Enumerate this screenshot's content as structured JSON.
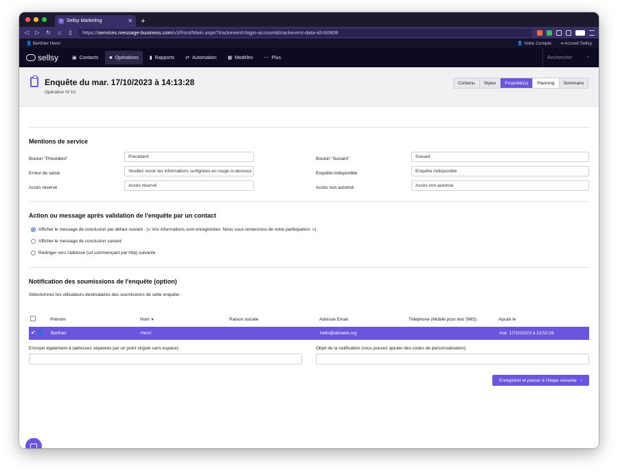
{
  "browser": {
    "tab_title": "Sellsy Marketing",
    "url_prefix": "https://",
    "url_host": "services.message-business.com",
    "url_path": "/v3/front/Main.aspx?trackevent=login-account&trackevent-data-id=60908"
  },
  "userstrip": {
    "user": "Berthier Henri",
    "account": "Votre Compte",
    "home": "Accueil Sellsy"
  },
  "nav": {
    "logo": "sellsy",
    "items": [
      "Contacts",
      "Opérations",
      "Rapports",
      "Automation",
      "Modèles",
      "Plus"
    ],
    "search_placeholder": "Rechercher"
  },
  "page": {
    "title": "Enquête du mar. 17/10/2023 à 14:13:28",
    "subtitle": "Opération N°10",
    "tabs": [
      "Contenu",
      "Styles",
      "Propriété(s)",
      "Planning",
      "Sommaire"
    ]
  },
  "mentions": {
    "title": "Mentions de service",
    "prev_label": "Bouton \"Précédent\"",
    "prev_value": "Précédent",
    "next_label": "Bouton \"Suivant\"",
    "next_value": "Suivant",
    "error_label": "Erreur de saisie",
    "error_value": "Veuillez revoir les informations surlignées en rouge ci-dessous",
    "unavail_label": "Enquête indisponible",
    "unavail_value": "Enquête indisponible",
    "reserved_label": "Accès réservé",
    "reserved_value": "Accès réservé",
    "unauth_label": "Accès non autorisé",
    "unauth_value": "Accès non autorisé"
  },
  "action": {
    "title": "Action ou message après validation de l'enquête par un contact",
    "options": [
      "Afficher le message de conclusion par défaut suivant : (« Vos informations sont enregistrées. Nous vous remercions de votre participation. »)",
      "Afficher le message de conclusion suivant",
      "Rediriger vers l'adresse (url commençant par http) suivante"
    ]
  },
  "notification": {
    "title": "Notification des soumissions de l'enquête (option)",
    "hint": "Sélectionnez les utilisateurs destinataires des soumissions de cette enquête :",
    "columns": [
      "Prénom",
      "Nom",
      "Raison sociale",
      "Adresse Email",
      "Téléphone (Mobile pour test SMS)",
      "Ajouté le"
    ],
    "row": {
      "prenom": "Berthier",
      "nom": "Henri",
      "raison": "",
      "email": "hello@alloweb.org",
      "tel": "",
      "added": "mar. 17/10/2023 à 13:52:29"
    },
    "also_label": "Envoyer également à (adresses séparées par un point virgule sans espace)",
    "subject_label": "Objet de la notification (vous pouvez ajouter des codes de personnalisation)",
    "save_button": "Enregistrer et passer à l'étape suivante"
  },
  "colors": {
    "accent": "#6a55e0",
    "nav_bg": "#0d0b22"
  }
}
